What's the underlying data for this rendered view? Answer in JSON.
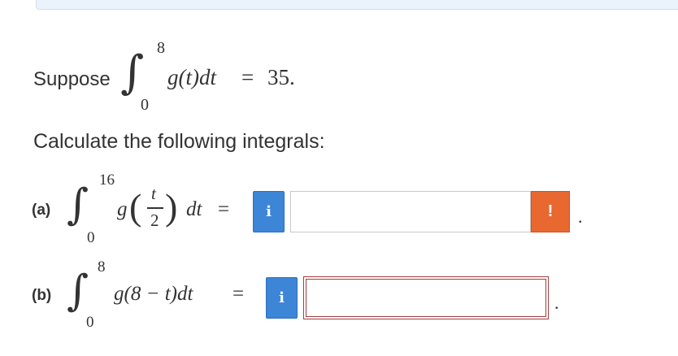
{
  "premise": {
    "lead": "Suppose",
    "upper_limit": "8",
    "lower_limit": "0",
    "integrand": "g(t)dt",
    "equals": "=",
    "value": "35."
  },
  "instruction": "Calculate the following integrals:",
  "part_a": {
    "label": "(a)",
    "upper_limit": "16",
    "lower_limit": "0",
    "func": "g",
    "frac_num": "t",
    "frac_den": "2",
    "dt": "dt",
    "equals": "=",
    "info_label": "i",
    "warning_label": "!",
    "answer_value": "",
    "trailing": "."
  },
  "part_b": {
    "label": "(b)",
    "upper_limit": "8",
    "lower_limit": "0",
    "integrand": "g(8 − t)dt",
    "equals": "=",
    "info_label": "i",
    "answer_value": "",
    "trailing": "."
  },
  "colors": {
    "info_button": "#3d85d6",
    "warning_button": "#e8682f",
    "error_border": "#a33c3c",
    "text": "#333333"
  }
}
